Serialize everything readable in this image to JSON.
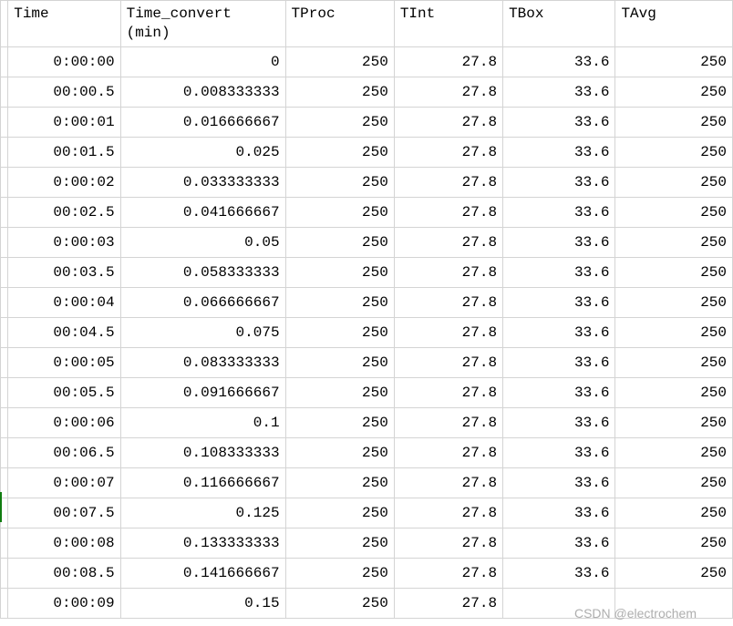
{
  "headers": {
    "time": "Time",
    "time_convert": "Time_convert\n(min)",
    "tproc": "TProc",
    "tint": "TInt",
    "tbox": "TBox",
    "tavg": "TAvg"
  },
  "rows": [
    {
      "time": "0:00:00",
      "conv": "0",
      "tproc": "250",
      "tint": "27.8",
      "tbox": "33.6",
      "tavg": "250"
    },
    {
      "time": "00:00.5",
      "conv": "0.008333333",
      "tproc": "250",
      "tint": "27.8",
      "tbox": "33.6",
      "tavg": "250"
    },
    {
      "time": "0:00:01",
      "conv": "0.016666667",
      "tproc": "250",
      "tint": "27.8",
      "tbox": "33.6",
      "tavg": "250"
    },
    {
      "time": "00:01.5",
      "conv": "0.025",
      "tproc": "250",
      "tint": "27.8",
      "tbox": "33.6",
      "tavg": "250"
    },
    {
      "time": "0:00:02",
      "conv": "0.033333333",
      "tproc": "250",
      "tint": "27.8",
      "tbox": "33.6",
      "tavg": "250"
    },
    {
      "time": "00:02.5",
      "conv": "0.041666667",
      "tproc": "250",
      "tint": "27.8",
      "tbox": "33.6",
      "tavg": "250"
    },
    {
      "time": "0:00:03",
      "conv": "0.05",
      "tproc": "250",
      "tint": "27.8",
      "tbox": "33.6",
      "tavg": "250"
    },
    {
      "time": "00:03.5",
      "conv": "0.058333333",
      "tproc": "250",
      "tint": "27.8",
      "tbox": "33.6",
      "tavg": "250"
    },
    {
      "time": "0:00:04",
      "conv": "0.066666667",
      "tproc": "250",
      "tint": "27.8",
      "tbox": "33.6",
      "tavg": "250"
    },
    {
      "time": "00:04.5",
      "conv": "0.075",
      "tproc": "250",
      "tint": "27.8",
      "tbox": "33.6",
      "tavg": "250"
    },
    {
      "time": "0:00:05",
      "conv": "0.083333333",
      "tproc": "250",
      "tint": "27.8",
      "tbox": "33.6",
      "tavg": "250"
    },
    {
      "time": "00:05.5",
      "conv": "0.091666667",
      "tproc": "250",
      "tint": "27.8",
      "tbox": "33.6",
      "tavg": "250"
    },
    {
      "time": "0:00:06",
      "conv": "0.1",
      "tproc": "250",
      "tint": "27.8",
      "tbox": "33.6",
      "tavg": "250"
    },
    {
      "time": "00:06.5",
      "conv": "0.108333333",
      "tproc": "250",
      "tint": "27.8",
      "tbox": "33.6",
      "tavg": "250"
    },
    {
      "time": "0:00:07",
      "conv": "0.116666667",
      "tproc": "250",
      "tint": "27.8",
      "tbox": "33.6",
      "tavg": "250"
    },
    {
      "time": "00:07.5",
      "conv": "0.125",
      "tproc": "250",
      "tint": "27.8",
      "tbox": "33.6",
      "tavg": "250"
    },
    {
      "time": "0:00:08",
      "conv": "0.133333333",
      "tproc": "250",
      "tint": "27.8",
      "tbox": "33.6",
      "tavg": "250"
    },
    {
      "time": "00:08.5",
      "conv": "0.141666667",
      "tproc": "250",
      "tint": "27.8",
      "tbox": "33.6",
      "tavg": "250"
    },
    {
      "time": "0:00:09",
      "conv": "0.15",
      "tproc": "250",
      "tint": "27.8",
      "tbox": "",
      "tavg": ""
    }
  ],
  "watermark": "CSDN @electrochem"
}
